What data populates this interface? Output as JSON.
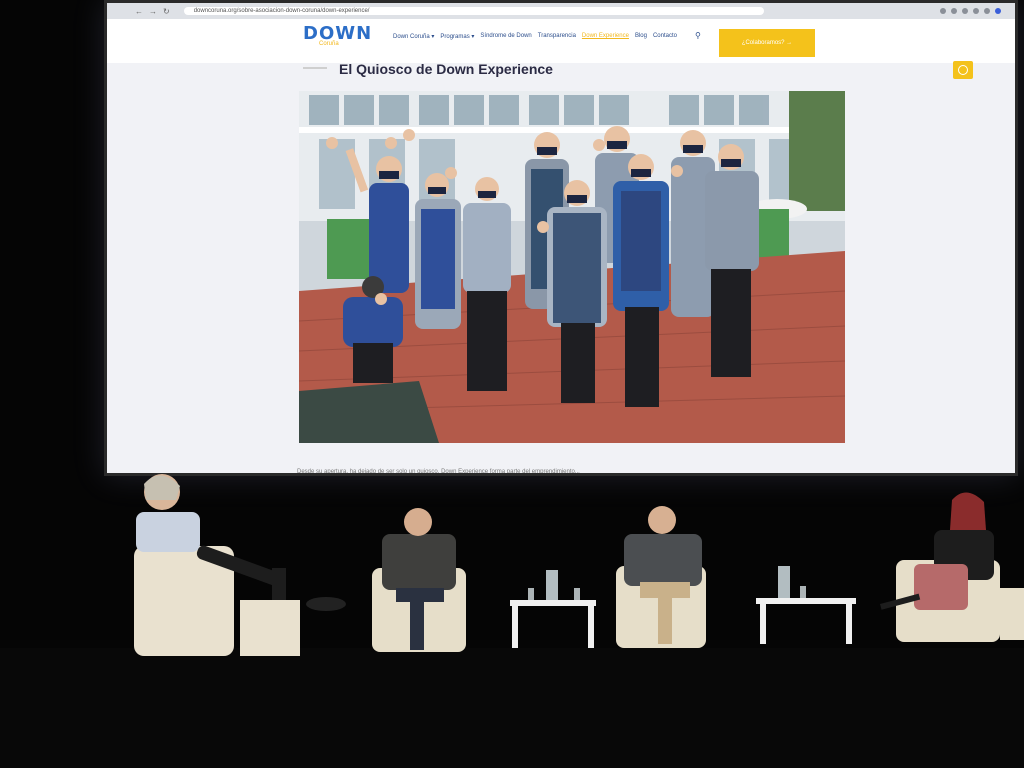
{
  "browser": {
    "url": "downcoruna.org/sobre-asociacion-down-coruna/down-experience/",
    "nav_back": "←",
    "nav_forward": "→",
    "nav_reload": "↻"
  },
  "site": {
    "logo_text": "DOWN",
    "logo_sub": "Coruña",
    "menu": [
      "Down Coruña ▾",
      "Programas ▾",
      "Síndrome de Down",
      "Transparencia",
      "Down Experience",
      "Blog",
      "Contacto"
    ],
    "cta_label": "¿Colaboramos? →",
    "page_title": "El Quiosco de Down Experience",
    "below_text": "Desde su apertura, ha dejado de ser solo un quiosco. Down Experience forma parte del emprendimiento..."
  },
  "colors": {
    "brand_blue": "#2c6ec7",
    "brand_yellow": "#f4c21b",
    "stage_black": "#050505"
  },
  "icons": {
    "search": "search-icon",
    "chat": "chat-icon"
  }
}
